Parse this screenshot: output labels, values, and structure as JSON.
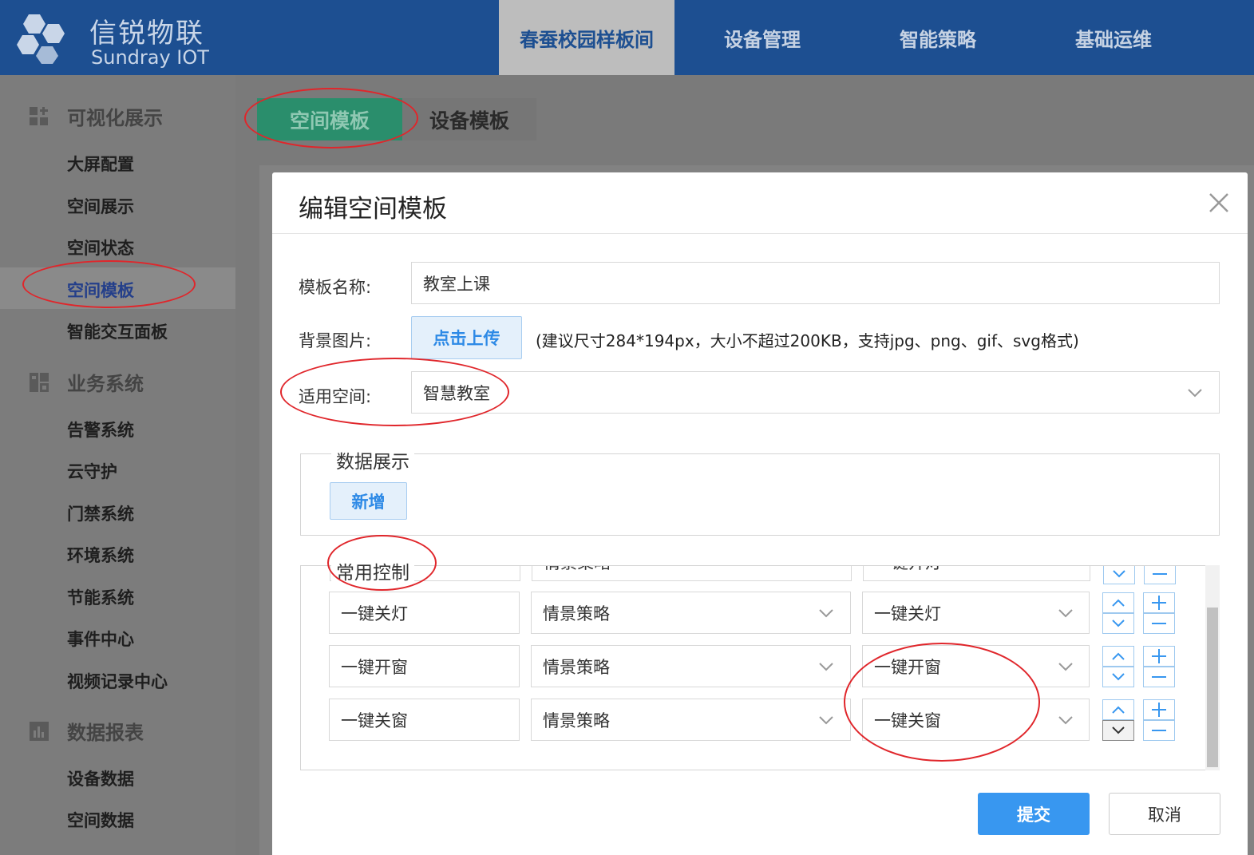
{
  "header": {
    "logo_cn": "信锐物联",
    "logo_en": "Sundray IOT",
    "nav": [
      "春蚕校园样板间",
      "设备管理",
      "智能策略",
      "基础运维"
    ],
    "nav_active_index": 0
  },
  "sidebar": {
    "groups": [
      {
        "title": "可视化展示",
        "icon": "dashboard-icon",
        "items": [
          "大屏配置",
          "空间展示",
          "空间状态",
          "空间模板",
          "智能交互面板"
        ]
      },
      {
        "title": "业务系统",
        "icon": "business-icon",
        "items": [
          "告警系统",
          "云守护",
          "门禁系统",
          "环境系统",
          "节能系统",
          "事件中心",
          "视频记录中心"
        ]
      },
      {
        "title": "数据报表",
        "icon": "report-icon",
        "items": [
          "设备数据",
          "空间数据"
        ]
      }
    ],
    "active_item": "空间模板"
  },
  "tabs": [
    "空间模板",
    "设备模板"
  ],
  "modal": {
    "title": "编辑空间模板",
    "fields": {
      "name_label": "模板名称:",
      "name_value": "教室上课",
      "bg_label": "背景图片:",
      "upload_label": "点击上传",
      "upload_hint": "(建议尺寸284*194px，大小不超过200KB，支持jpg、png、gif、svg格式)",
      "space_label": "适用空间:",
      "space_value": "智慧教室"
    },
    "data_display": {
      "legend": "数据展示",
      "add_label": "新增"
    },
    "common_control": {
      "legend": "常用控制",
      "partial_row": {
        "name": "一键开",
        "type": "情景策略",
        "target": "一键开灯"
      },
      "rows": [
        {
          "name": "一键关灯",
          "type": "情景策略",
          "target": "一键关灯"
        },
        {
          "name": "一键开窗",
          "type": "情景策略",
          "target": "一键开窗"
        },
        {
          "name": "一键关窗",
          "type": "情景策略",
          "target": "一键关窗"
        }
      ]
    },
    "submit_label": "提交",
    "cancel_label": "取消"
  },
  "colors": {
    "header_bg": "#1d4f91",
    "tab_active": "#2a8e6c",
    "primary_button": "#3897f0",
    "annotation_red": "#e0262b"
  }
}
